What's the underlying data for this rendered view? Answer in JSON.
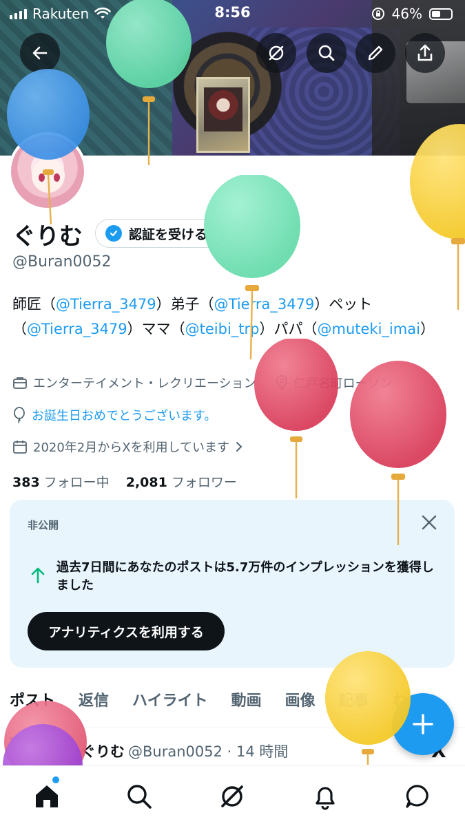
{
  "status_bar": {
    "carrier": "Rakuten",
    "time": "8:56",
    "battery": "46%"
  },
  "profile": {
    "name": "ぐりむ",
    "verify_label": "認証を受ける",
    "handle": "@Buran0052",
    "bio": [
      {
        "t": "師匠（",
        "m": false
      },
      {
        "t": "@Tierra_3479",
        "m": true
      },
      {
        "t": "）弟子（",
        "m": false
      },
      {
        "t": "@Tierra_3479",
        "m": true
      },
      {
        "t": "）ペット（",
        "m": false
      },
      {
        "t": "@Tierra_3479",
        "m": true
      },
      {
        "t": "）ママ（",
        "m": false
      },
      {
        "t": "@teibi_trp",
        "m": true
      },
      {
        "t": "）パパ（",
        "m": false
      },
      {
        "t": "@muteki_imai",
        "m": true
      },
      {
        "t": "）",
        "m": false
      }
    ],
    "category": "エンターテイメント・レクリエーション",
    "location": "仁戸名町ローソン",
    "birthday_text": "お誕生日おめでとうございます。",
    "joined": "2020年2月からXを利用しています",
    "following_count": "383",
    "following_label": "フォロー中",
    "followers_count": "2,081",
    "followers_label": "フォロワー"
  },
  "analytics_card": {
    "tag": "非公開",
    "message": "過去7日間にあなたのポストは5.7万件のインプレッションを獲得しました",
    "cta": "アナリティクスを利用する"
  },
  "tabs": [
    "ポスト",
    "返信",
    "ハイライト",
    "動画",
    "画像",
    "記事",
    "ね"
  ],
  "post_preview": {
    "name": "ぐりむ",
    "meta": "@Buran0052 · 14 時間",
    "platform_mark": "X"
  },
  "icons": {
    "back": "back-arrow-icon",
    "grok": "grok-icon",
    "search": "search-icon",
    "edit": "pencil-icon",
    "share": "share-icon",
    "nav": [
      "home-icon",
      "search-icon",
      "grok-icon",
      "bell-icon",
      "message-icon"
    ]
  },
  "colors": {
    "accent": "#1d9bf0",
    "text": "#0f1419",
    "muted": "#536471",
    "card_bg": "#e8f5fd"
  }
}
